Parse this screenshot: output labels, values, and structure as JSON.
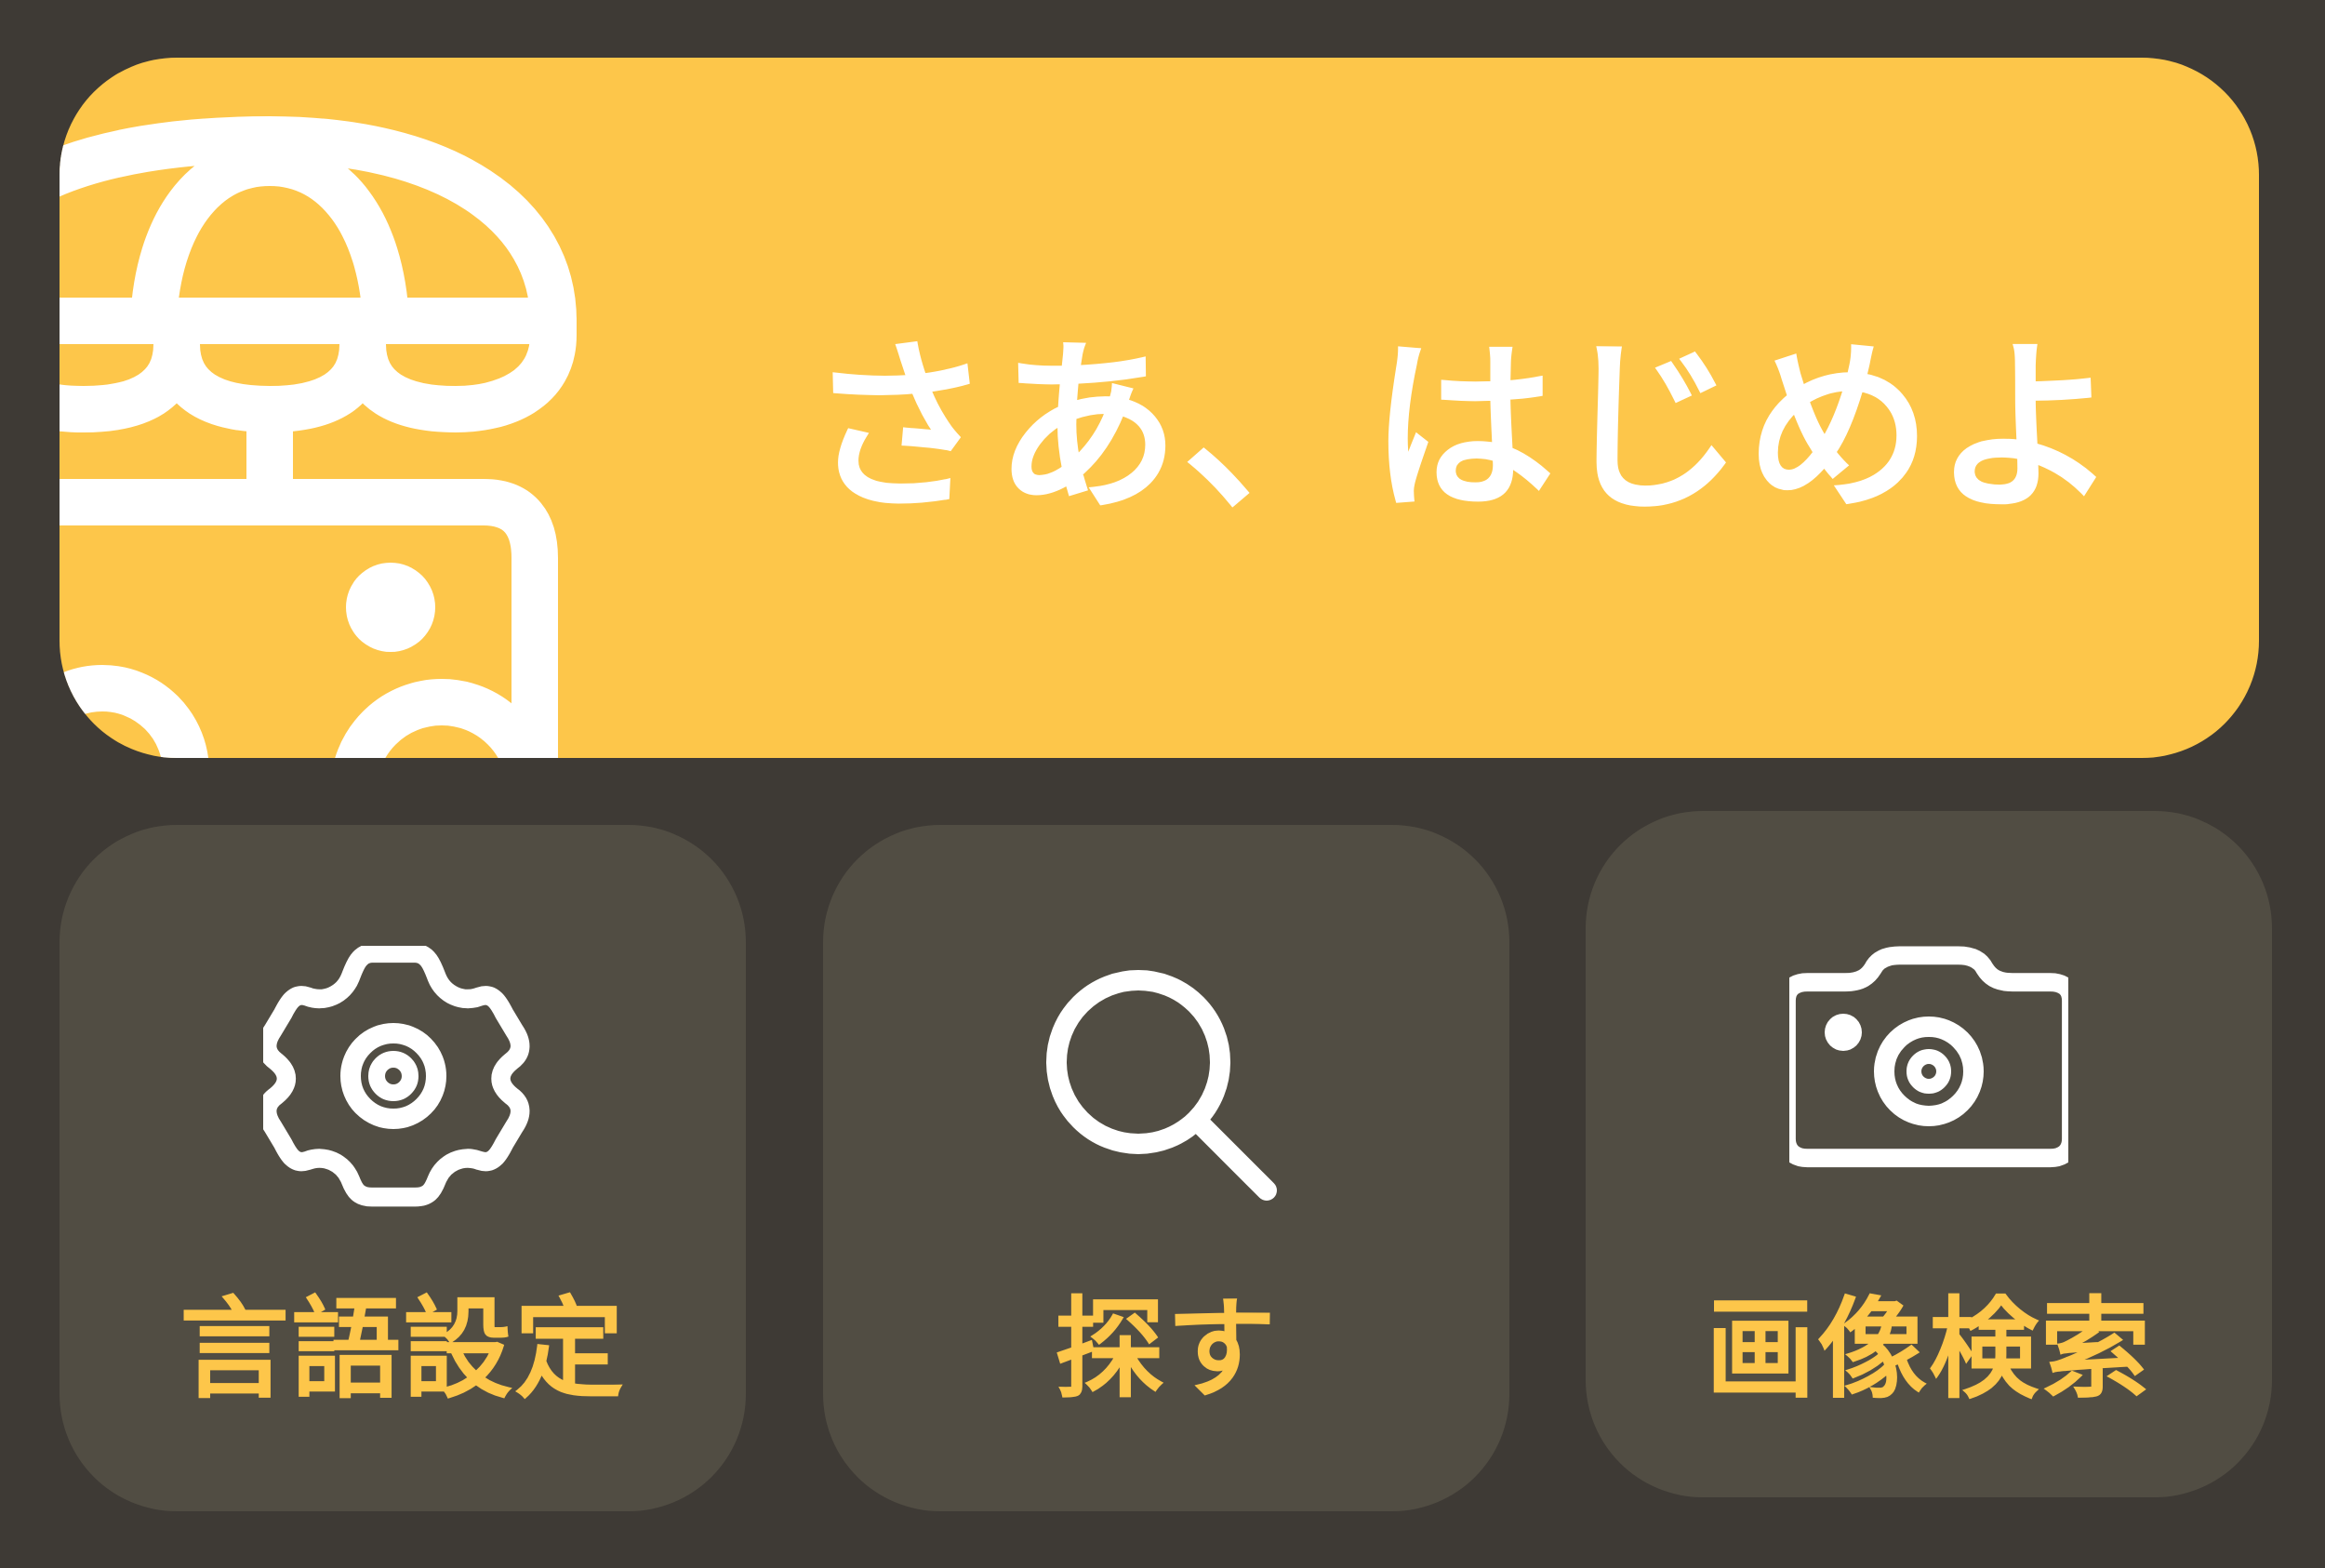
{
  "hero": {
    "title": "さあ、はじめよ",
    "icon": "food-cart-icon",
    "background_color": "#fdc64a",
    "text_color": "#ffffff"
  },
  "tiles": [
    {
      "label": "言語設定",
      "icon": "gear-icon"
    },
    {
      "label": "探す",
      "icon": "search-icon"
    },
    {
      "label": "画像検索",
      "icon": "camera-icon"
    }
  ],
  "colors": {
    "page_background": "#3e3a35",
    "tile_background": "#514d43",
    "accent": "#fdc64a",
    "icon_stroke": "#ffffff"
  }
}
